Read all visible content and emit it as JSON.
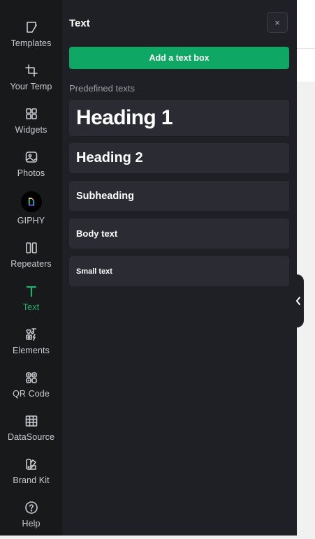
{
  "sidebar": {
    "items": [
      {
        "label": "Templates",
        "icon": "templates-icon"
      },
      {
        "label": "Your Temp",
        "icon": "crop-icon"
      },
      {
        "label": "Widgets",
        "icon": "widgets-icon"
      },
      {
        "label": "Photos",
        "icon": "photo-icon"
      },
      {
        "label": "GIPHY",
        "icon": "giphy-icon"
      },
      {
        "label": "Repeaters",
        "icon": "repeaters-icon"
      },
      {
        "label": "Text",
        "icon": "text-icon",
        "active": true
      },
      {
        "label": "Elements",
        "icon": "elements-icon"
      },
      {
        "label": "QR Code",
        "icon": "qr-code-icon"
      },
      {
        "label": "DataSource",
        "icon": "table-icon"
      },
      {
        "label": "Brand Kit",
        "icon": "brand-kit-icon"
      },
      {
        "label": "Help",
        "icon": "help-icon"
      }
    ]
  },
  "panel": {
    "title": "Text",
    "close_label": "×",
    "add_button_label": "Add a text box",
    "section_label": "Predefined texts",
    "presets": [
      "Heading 1",
      "Heading 2",
      "Subheading",
      "Body text",
      "Small text"
    ]
  },
  "colors": {
    "accent": "#0fa764",
    "active_nav": "#1fb36a",
    "rail_bg": "#18191b",
    "panel_bg": "#1f2026",
    "card_bg": "#2a2b33"
  }
}
